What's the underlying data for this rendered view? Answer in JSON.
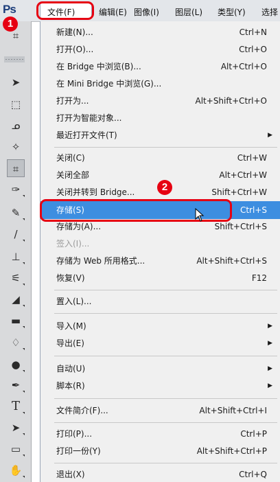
{
  "app": {
    "logo": "Ps"
  },
  "menubar": {
    "items": [
      {
        "label": "文件(F)"
      },
      {
        "label": "编辑(E)"
      },
      {
        "label": "图像(I)"
      },
      {
        "label": "图层(L)"
      },
      {
        "label": "类型(Y)"
      },
      {
        "label": "选择"
      }
    ]
  },
  "tools": [
    "crop-icon",
    "move-icon",
    "marquee-icon",
    "lasso-icon",
    "quick-select-icon",
    "crop-icon",
    "eyedropper-icon",
    "healing-brush-icon",
    "brush-icon",
    "stamp-icon",
    "history-brush-icon",
    "eraser-icon",
    "gradient-icon",
    "blur-icon",
    "dodge-icon",
    "pen-icon",
    "type-icon",
    "path-select-icon",
    "shape-icon",
    "hand-icon"
  ],
  "file_menu": {
    "new": {
      "label": "新建(N)...",
      "shortcut": "Ctrl+N"
    },
    "open": {
      "label": "打开(O)...",
      "shortcut": "Ctrl+O"
    },
    "browse_bridge": {
      "label": "在 Bridge 中浏览(B)...",
      "shortcut": "Alt+Ctrl+O"
    },
    "browse_mini_bridge": {
      "label": "在 Mini Bridge 中浏览(G)..."
    },
    "open_as": {
      "label": "打开为...",
      "shortcut": "Alt+Shift+Ctrl+O"
    },
    "open_smart": {
      "label": "打开为智能对象..."
    },
    "recent": {
      "label": "最近打开文件(T)"
    },
    "close": {
      "label": "关闭(C)",
      "shortcut": "Ctrl+W"
    },
    "close_all": {
      "label": "关闭全部",
      "shortcut": "Alt+Ctrl+W"
    },
    "close_bridge": {
      "label": "关闭并转到 Bridge...",
      "shortcut": "Shift+Ctrl+W"
    },
    "save": {
      "label": "存储(S)",
      "shortcut": "Ctrl+S"
    },
    "save_as": {
      "label": "存储为(A)...",
      "shortcut": "Shift+Ctrl+S"
    },
    "check_in": {
      "label": "签入(I)..."
    },
    "save_web": {
      "label": "存储为 Web 所用格式...",
      "shortcut": "Alt+Shift+Ctrl+S"
    },
    "revert": {
      "label": "恢复(V)",
      "shortcut": "F12"
    },
    "place": {
      "label": "置入(L)..."
    },
    "import": {
      "label": "导入(M)"
    },
    "export": {
      "label": "导出(E)"
    },
    "automate": {
      "label": "自动(U)"
    },
    "scripts": {
      "label": "脚本(R)"
    },
    "file_info": {
      "label": "文件简介(F)...",
      "shortcut": "Alt+Shift+Ctrl+I"
    },
    "print": {
      "label": "打印(P)...",
      "shortcut": "Ctrl+P"
    },
    "print_one": {
      "label": "打印一份(Y)",
      "shortcut": "Alt+Shift+Ctrl+P"
    },
    "exit": {
      "label": "退出(X)",
      "shortcut": "Ctrl+Q"
    }
  },
  "annotations": {
    "step1": "1",
    "step2": "2",
    "color": "#e60012"
  },
  "colors": {
    "highlight": "#3d8ee0",
    "menu_bg": "#f0f0f0"
  }
}
